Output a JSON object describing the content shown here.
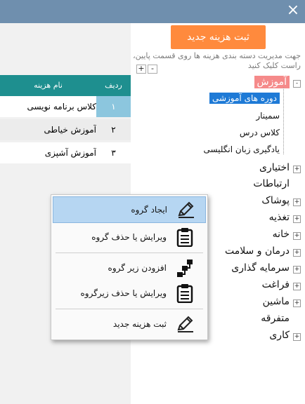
{
  "window": {
    "close_label": "×"
  },
  "toolbar": {
    "new_expense_label": "ثبت هزینه جدید"
  },
  "hint": "جهت مدیریت دسته بندی هزینه ها روی قسمت پایین، راست کلیک کنید",
  "tree_controls": {
    "expand": "+",
    "collapse": "-"
  },
  "grid": {
    "headers": {
      "num": "ردیف",
      "name": "نام هزینه"
    },
    "rows": [
      {
        "num": "۱",
        "name": "کلاس برنامه نویسی"
      },
      {
        "num": "۲",
        "name": "آموزش خیاطی"
      },
      {
        "num": "۳",
        "name": "آموزش آشپزی"
      }
    ]
  },
  "tree": {
    "root": "آموزش",
    "children": [
      "دوره های آموزشی",
      "سمینار",
      "کلاس درس",
      "یادگیری زبان انگلیسی"
    ],
    "categories": [
      "اختیاری",
      "ارتباطات",
      "پوشاک",
      "تغذیه",
      "خانه",
      "درمان و سلامت",
      "سرمایه گذاری",
      "فراغت",
      "ماشین",
      "متفرقه",
      "کاری"
    ]
  },
  "menu": {
    "items": [
      {
        "label": "ایجاد گروه",
        "icon": "pencil-icon"
      },
      {
        "label": "ویرایش یا حذف گروه",
        "icon": "clipboard-icon"
      },
      {
        "label": "افزودن زیر گروه",
        "icon": "hierarchy-icon"
      },
      {
        "label": "ویرایش یا حذف زیرگروه",
        "icon": "clipboard-icon"
      },
      {
        "label": "ثبت هزینه جدید",
        "icon": "pencil-icon"
      }
    ]
  },
  "colors": {
    "titlebar": "#6f8fae",
    "accent_button": "#ff8a3d",
    "grid_header": "#1e8f8f",
    "tree_selected": "#1e7ad6",
    "root_highlight": "#f58a8a"
  }
}
